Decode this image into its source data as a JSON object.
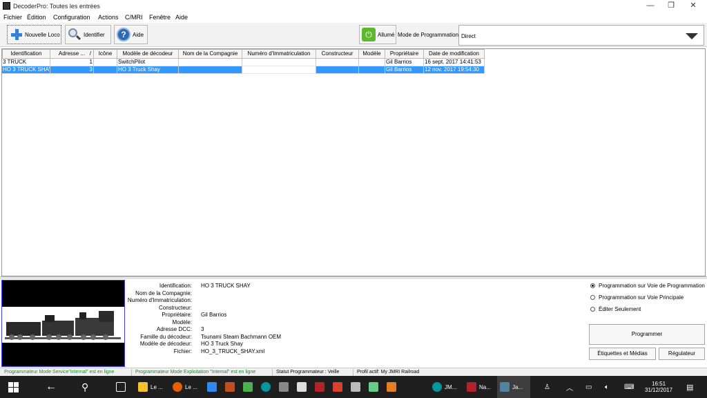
{
  "window": {
    "title": "DecoderPro: Toutes les entrées",
    "min": "—",
    "max": "❐",
    "close": "✕"
  },
  "menu": [
    "Fichier",
    "Édition",
    "Configuration",
    "Actions",
    "C/MRI",
    "Fenêtre",
    "Aide"
  ],
  "toolbar": {
    "new_loco": "Nouvelle Loco",
    "identify": "Identifier",
    "help": "Aide",
    "power": "Allumé",
    "mode_label": "Mode de Programmation",
    "mode_value": "Direct"
  },
  "table": {
    "columns": [
      "Identification",
      "Adresse ...",
      "Icône",
      "Modèle de décodeur",
      "Nom de la Compagnie",
      "Numéro d'Immatriculation",
      "Constructeur",
      "Modèle",
      "Propriétaire",
      "Date de modification"
    ],
    "sort_indicator": "/",
    "rows": [
      [
        "3 TRUCK",
        "1",
        "",
        "SwitchPilot",
        "",
        "",
        "",
        "",
        "Gil Barrios",
        "16 sept. 2017 14:41:53"
      ],
      [
        "HO 3 TRUCK SHAY",
        "3",
        "",
        "HO 3 Truck Shay",
        "",
        "",
        "",
        "",
        "Gil Barrios",
        "12 nov. 2017 19:54:30"
      ]
    ],
    "selected_row": 1
  },
  "details": [
    {
      "label": "Identification:",
      "value": "HO 3 TRUCK SHAY"
    },
    {
      "label": "Nom de la Compagnie:",
      "value": ""
    },
    {
      "label": "Numéro d'Immatriculation:",
      "value": ""
    },
    {
      "label": "Constructeur:",
      "value": ""
    },
    {
      "label": "Propriétaire:",
      "value": "Gil Barrios"
    },
    {
      "label": "Modèle:",
      "value": ""
    },
    {
      "label": "Adresse DCC:",
      "value": "3"
    },
    {
      "label": "Famille du décodeur:",
      "value": "Tsunami Steam Bachmann OEM"
    },
    {
      "label": "Modèle de décodeur:",
      "value": "HO 3 Truck Shay"
    },
    {
      "label": "Fichier:",
      "value": "HO_3_TRUCK_SHAY.xml"
    }
  ],
  "programming": {
    "options": [
      "Programmation sur Voie de Programmation",
      "Programmation sur Voie Principale",
      "Éditer Seulement"
    ],
    "selected": 0,
    "program_button": "Programmer",
    "labels_button": "Étiquettes et Médias",
    "throttle_button": "Régulateur"
  },
  "status": {
    "service": "Programmateur Mode Service\"Internal\" est en ligne",
    "ops": "Programmateur Mode Exploitation \"Internal\" est en ligne",
    "prog_status": "Statut Programmateur :  Veille",
    "profile": "Profil actif: My JMRI Railroad"
  },
  "taskbar": {
    "apps": [
      {
        "label": "Le ...",
        "color": "#f2c12e"
      },
      {
        "label": "Le ...",
        "color": "#e66000"
      },
      {
        "label": "JM...",
        "color": "#00979c"
      },
      {
        "label": "Na...",
        "color": "#b0232a"
      },
      {
        "label": "Ja...",
        "color": "#5382a1"
      }
    ],
    "time": "16:51",
    "date": "31/12/2017"
  }
}
